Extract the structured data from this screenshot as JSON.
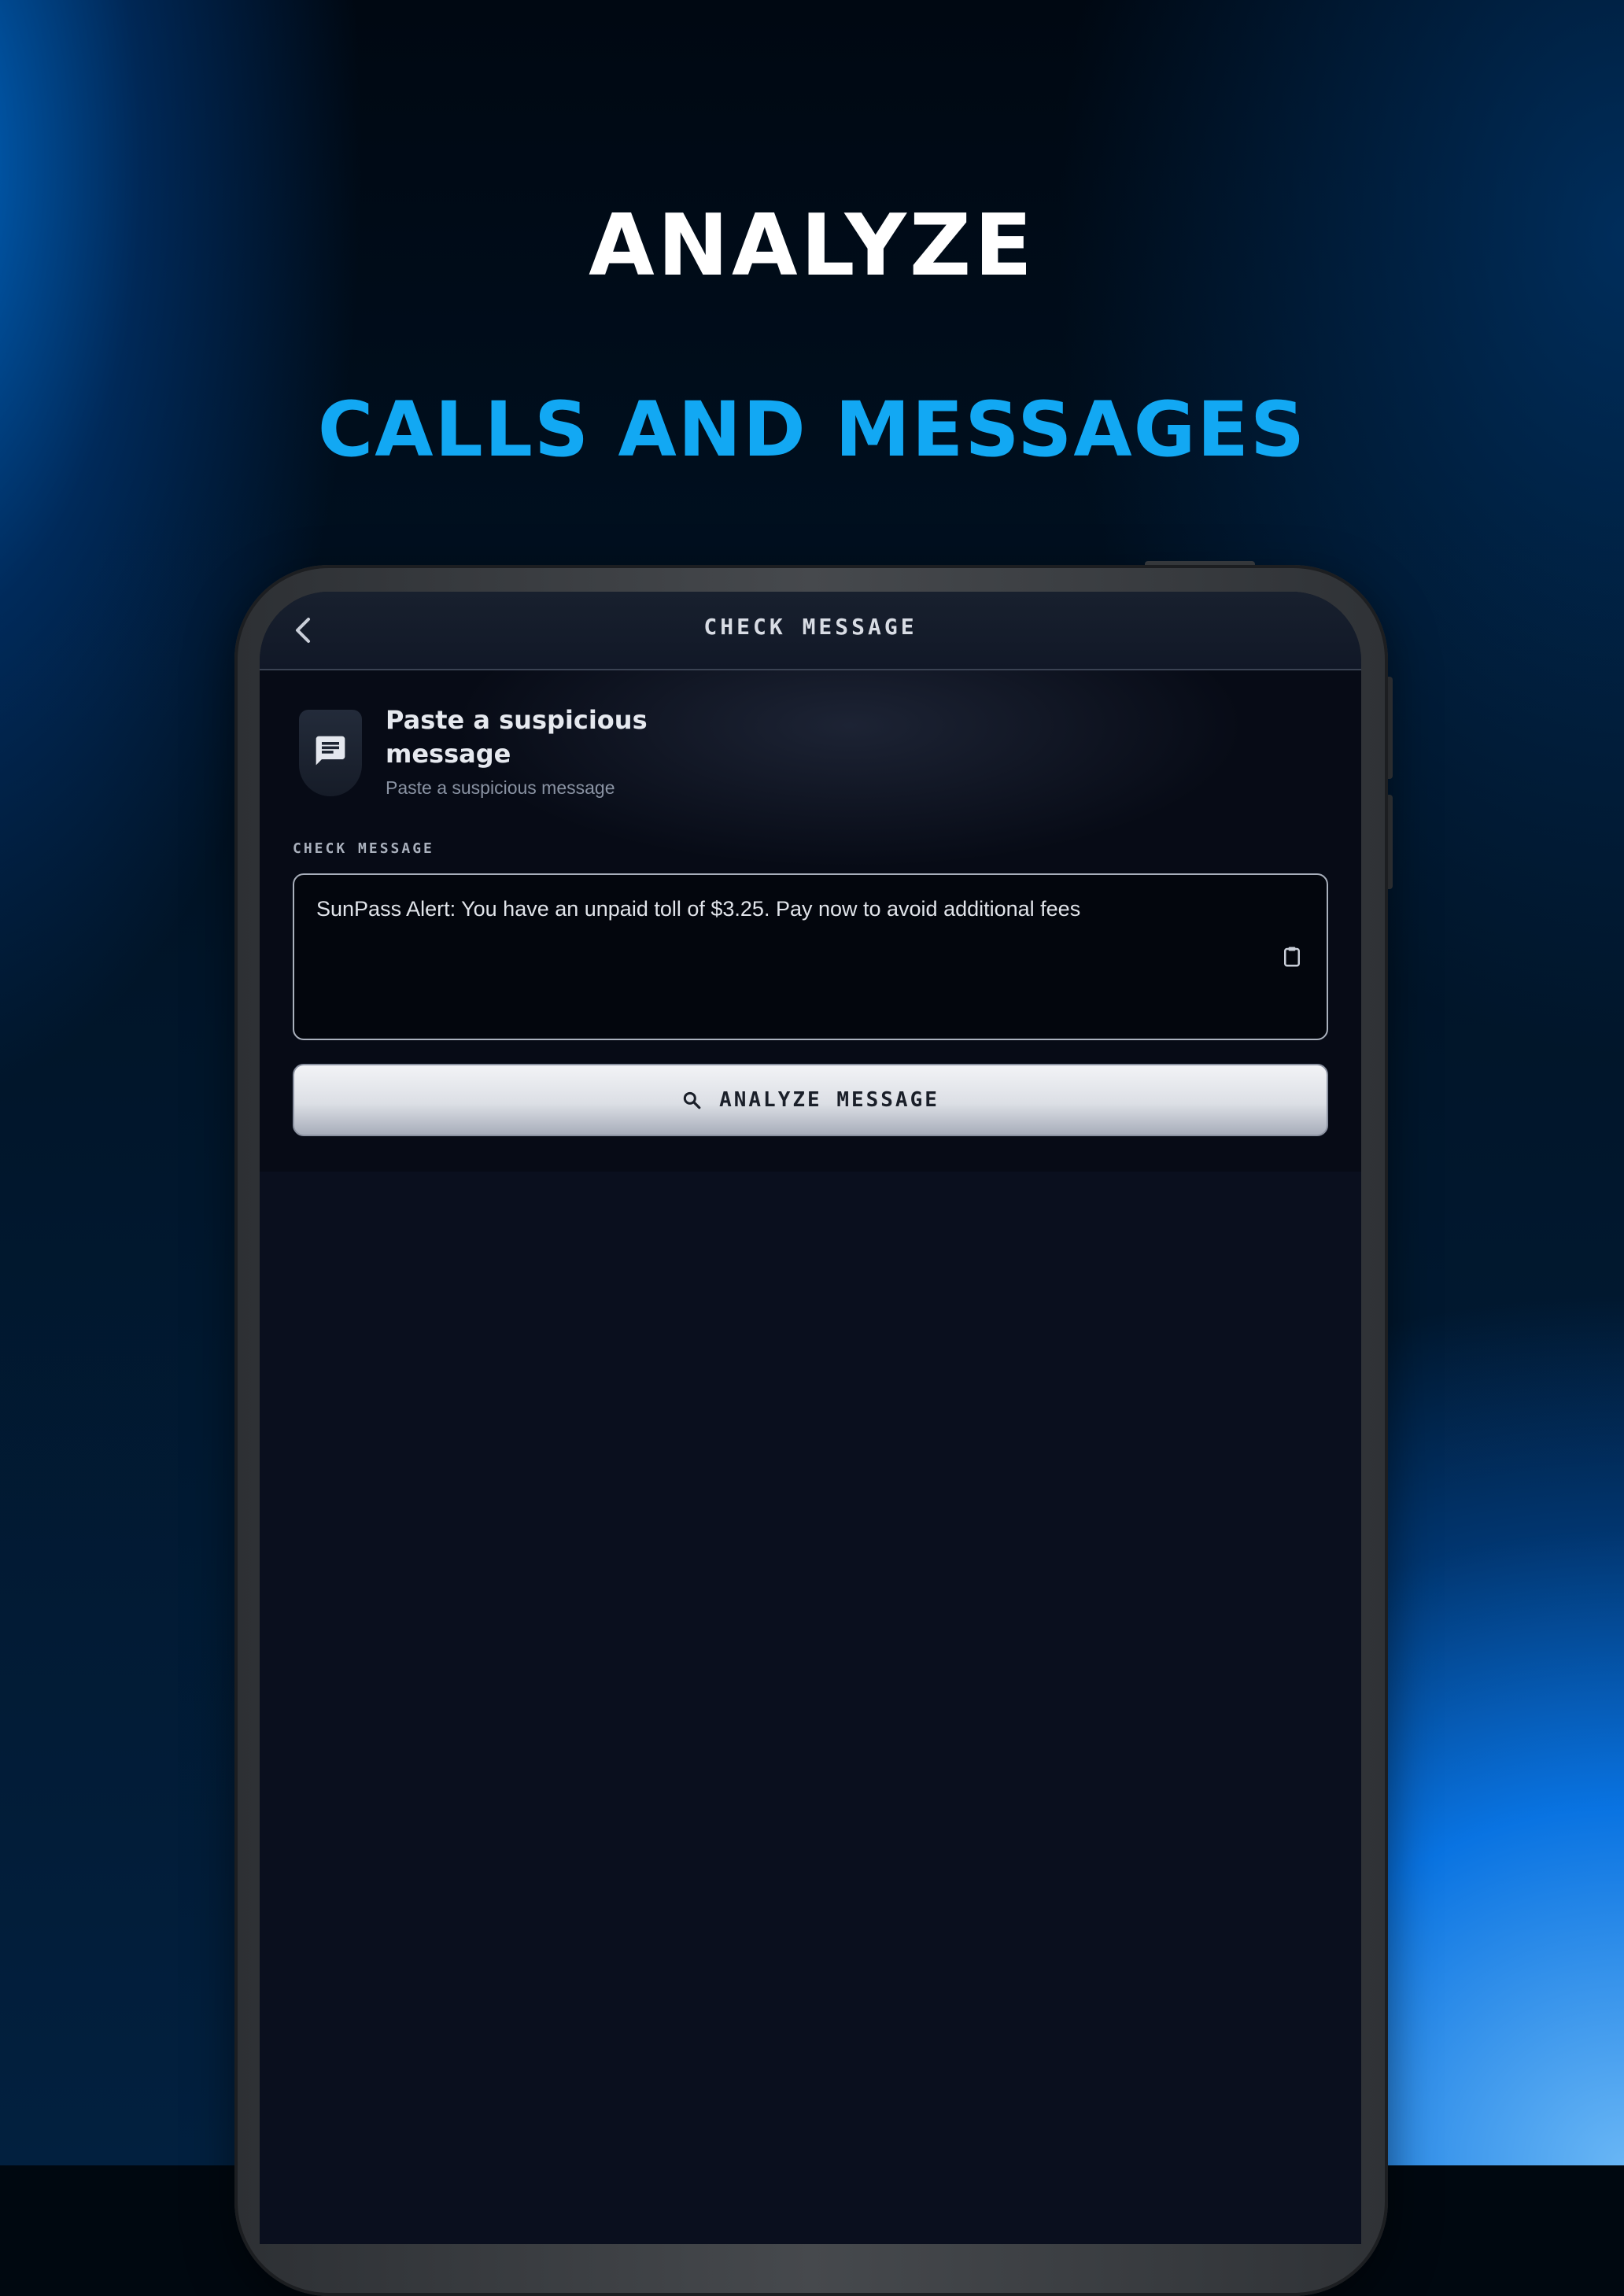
{
  "promo": {
    "headline_primary": "ANALYZE",
    "headline_secondary": "CALLS AND MESSAGES"
  },
  "app": {
    "header": {
      "title": "CHECK MESSAGE",
      "back_icon": "chevron-left-icon"
    },
    "intro": {
      "icon": "message-icon",
      "title": "Paste a suspicious message",
      "subtitle": "Paste a suspicious message"
    },
    "form": {
      "field_label": "CHECK MESSAGE",
      "message_value": "SunPass Alert: You have an unpaid toll of $3.25. Pay now to avoid additional fees",
      "paste_icon": "clipboard-icon",
      "analyze_button_label": "ANALYZE MESSAGE",
      "analyze_button_icon": "search-icon"
    }
  },
  "colors": {
    "accent_blue": "#12a8f3",
    "headline_white": "#ffffff",
    "screen_background": "#0a0f1e"
  }
}
